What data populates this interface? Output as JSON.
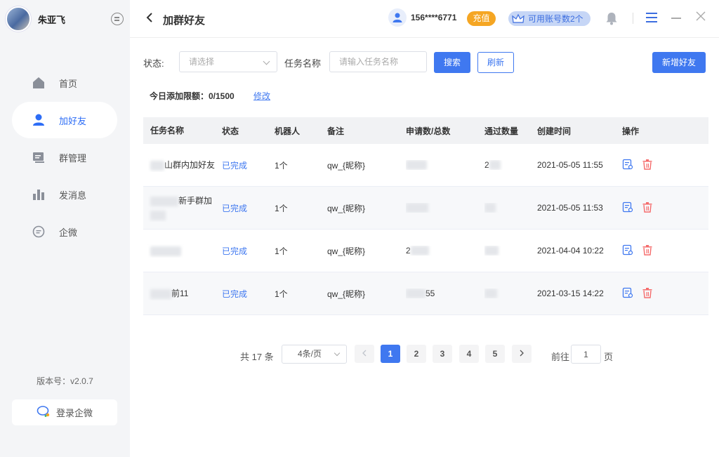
{
  "sidebar": {
    "user_name": "朱亚飞",
    "items": [
      {
        "label": "首页",
        "icon": "home-icon"
      },
      {
        "label": "加好友",
        "icon": "user-icon"
      },
      {
        "label": "群管理",
        "icon": "group-manage-icon"
      },
      {
        "label": "发消息",
        "icon": "bar-chart-icon"
      },
      {
        "label": "企微",
        "icon": "chat-icon"
      }
    ],
    "active_index": 1,
    "version": "版本号：v2.0.7",
    "login_label": "登录企微"
  },
  "header": {
    "title": "加群好友",
    "phone": "156****6771",
    "recharge_label": "充值",
    "available_label": "可用账号数2个"
  },
  "toolbar": {
    "status_label": "状态:",
    "status_placeholder": "请选择",
    "task_name_label": "任务名称",
    "task_name_placeholder": "请输入任务名称",
    "search_label": "搜索",
    "refresh_label": "刷新",
    "add_friend_label": "新增好友"
  },
  "limit": {
    "text": "今日添加限额：0/1500",
    "modify_label": "修改"
  },
  "table": {
    "headers": [
      "任务名称",
      "状态",
      "机器人",
      "备注",
      "申请数/总数",
      "通过数量",
      "创建时间",
      "操作"
    ],
    "rows": [
      {
        "name": "山群内加好友",
        "status": "已完成",
        "robot": "1个",
        "note": "qw_{昵称}",
        "apply": "",
        "passed": "2",
        "created": "2021-05-05 11:55"
      },
      {
        "name": "新手群加",
        "status": "已完成",
        "robot": "1个",
        "note": "qw_{昵称}",
        "apply": "",
        "passed": "",
        "created": "2021-05-05 11:53"
      },
      {
        "name": "",
        "status": "已完成",
        "robot": "1个",
        "note": "qw_{昵称}",
        "apply": "2",
        "passed": "",
        "created": "2021-04-04 10:22"
      },
      {
        "name": "前11",
        "status": "已完成",
        "robot": "1个",
        "note": "qw_{昵称}",
        "apply": "55",
        "passed": "",
        "created": "2021-03-15 14:22"
      }
    ]
  },
  "pagination": {
    "total": "共 17 条",
    "page_size": "4条/页",
    "pages": [
      "1",
      "2",
      "3",
      "4",
      "5"
    ],
    "current": "1",
    "goto_label": "前往",
    "goto_value": "1",
    "page_unit": "页"
  },
  "colors": {
    "primary": "#3f78f0",
    "recharge": "#f5a623",
    "delete": "#f56c6c"
  }
}
